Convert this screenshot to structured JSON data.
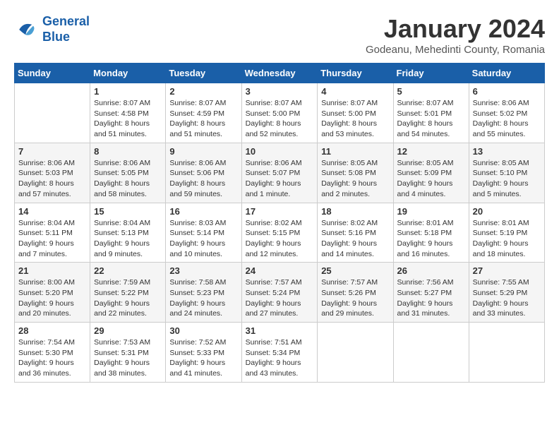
{
  "header": {
    "logo_line1": "General",
    "logo_line2": "Blue",
    "title": "January 2024",
    "location": "Godeanu, Mehedinti County, Romania"
  },
  "calendar": {
    "weekdays": [
      "Sunday",
      "Monday",
      "Tuesday",
      "Wednesday",
      "Thursday",
      "Friday",
      "Saturday"
    ],
    "weeks": [
      [
        {
          "day": "",
          "info": ""
        },
        {
          "day": "1",
          "info": "Sunrise: 8:07 AM\nSunset: 4:58 PM\nDaylight: 8 hours\nand 51 minutes."
        },
        {
          "day": "2",
          "info": "Sunrise: 8:07 AM\nSunset: 4:59 PM\nDaylight: 8 hours\nand 51 minutes."
        },
        {
          "day": "3",
          "info": "Sunrise: 8:07 AM\nSunset: 5:00 PM\nDaylight: 8 hours\nand 52 minutes."
        },
        {
          "day": "4",
          "info": "Sunrise: 8:07 AM\nSunset: 5:00 PM\nDaylight: 8 hours\nand 53 minutes."
        },
        {
          "day": "5",
          "info": "Sunrise: 8:07 AM\nSunset: 5:01 PM\nDaylight: 8 hours\nand 54 minutes."
        },
        {
          "day": "6",
          "info": "Sunrise: 8:06 AM\nSunset: 5:02 PM\nDaylight: 8 hours\nand 55 minutes."
        }
      ],
      [
        {
          "day": "7",
          "info": "Sunrise: 8:06 AM\nSunset: 5:03 PM\nDaylight: 8 hours\nand 57 minutes."
        },
        {
          "day": "8",
          "info": "Sunrise: 8:06 AM\nSunset: 5:05 PM\nDaylight: 8 hours\nand 58 minutes."
        },
        {
          "day": "9",
          "info": "Sunrise: 8:06 AM\nSunset: 5:06 PM\nDaylight: 8 hours\nand 59 minutes."
        },
        {
          "day": "10",
          "info": "Sunrise: 8:06 AM\nSunset: 5:07 PM\nDaylight: 9 hours\nand 1 minute."
        },
        {
          "day": "11",
          "info": "Sunrise: 8:05 AM\nSunset: 5:08 PM\nDaylight: 9 hours\nand 2 minutes."
        },
        {
          "day": "12",
          "info": "Sunrise: 8:05 AM\nSunset: 5:09 PM\nDaylight: 9 hours\nand 4 minutes."
        },
        {
          "day": "13",
          "info": "Sunrise: 8:05 AM\nSunset: 5:10 PM\nDaylight: 9 hours\nand 5 minutes."
        }
      ],
      [
        {
          "day": "14",
          "info": "Sunrise: 8:04 AM\nSunset: 5:11 PM\nDaylight: 9 hours\nand 7 minutes."
        },
        {
          "day": "15",
          "info": "Sunrise: 8:04 AM\nSunset: 5:13 PM\nDaylight: 9 hours\nand 9 minutes."
        },
        {
          "day": "16",
          "info": "Sunrise: 8:03 AM\nSunset: 5:14 PM\nDaylight: 9 hours\nand 10 minutes."
        },
        {
          "day": "17",
          "info": "Sunrise: 8:02 AM\nSunset: 5:15 PM\nDaylight: 9 hours\nand 12 minutes."
        },
        {
          "day": "18",
          "info": "Sunrise: 8:02 AM\nSunset: 5:16 PM\nDaylight: 9 hours\nand 14 minutes."
        },
        {
          "day": "19",
          "info": "Sunrise: 8:01 AM\nSunset: 5:18 PM\nDaylight: 9 hours\nand 16 minutes."
        },
        {
          "day": "20",
          "info": "Sunrise: 8:01 AM\nSunset: 5:19 PM\nDaylight: 9 hours\nand 18 minutes."
        }
      ],
      [
        {
          "day": "21",
          "info": "Sunrise: 8:00 AM\nSunset: 5:20 PM\nDaylight: 9 hours\nand 20 minutes."
        },
        {
          "day": "22",
          "info": "Sunrise: 7:59 AM\nSunset: 5:22 PM\nDaylight: 9 hours\nand 22 minutes."
        },
        {
          "day": "23",
          "info": "Sunrise: 7:58 AM\nSunset: 5:23 PM\nDaylight: 9 hours\nand 24 minutes."
        },
        {
          "day": "24",
          "info": "Sunrise: 7:57 AM\nSunset: 5:24 PM\nDaylight: 9 hours\nand 27 minutes."
        },
        {
          "day": "25",
          "info": "Sunrise: 7:57 AM\nSunset: 5:26 PM\nDaylight: 9 hours\nand 29 minutes."
        },
        {
          "day": "26",
          "info": "Sunrise: 7:56 AM\nSunset: 5:27 PM\nDaylight: 9 hours\nand 31 minutes."
        },
        {
          "day": "27",
          "info": "Sunrise: 7:55 AM\nSunset: 5:29 PM\nDaylight: 9 hours\nand 33 minutes."
        }
      ],
      [
        {
          "day": "28",
          "info": "Sunrise: 7:54 AM\nSunset: 5:30 PM\nDaylight: 9 hours\nand 36 minutes."
        },
        {
          "day": "29",
          "info": "Sunrise: 7:53 AM\nSunset: 5:31 PM\nDaylight: 9 hours\nand 38 minutes."
        },
        {
          "day": "30",
          "info": "Sunrise: 7:52 AM\nSunset: 5:33 PM\nDaylight: 9 hours\nand 41 minutes."
        },
        {
          "day": "31",
          "info": "Sunrise: 7:51 AM\nSunset: 5:34 PM\nDaylight: 9 hours\nand 43 minutes."
        },
        {
          "day": "",
          "info": ""
        },
        {
          "day": "",
          "info": ""
        },
        {
          "day": "",
          "info": ""
        }
      ]
    ]
  }
}
